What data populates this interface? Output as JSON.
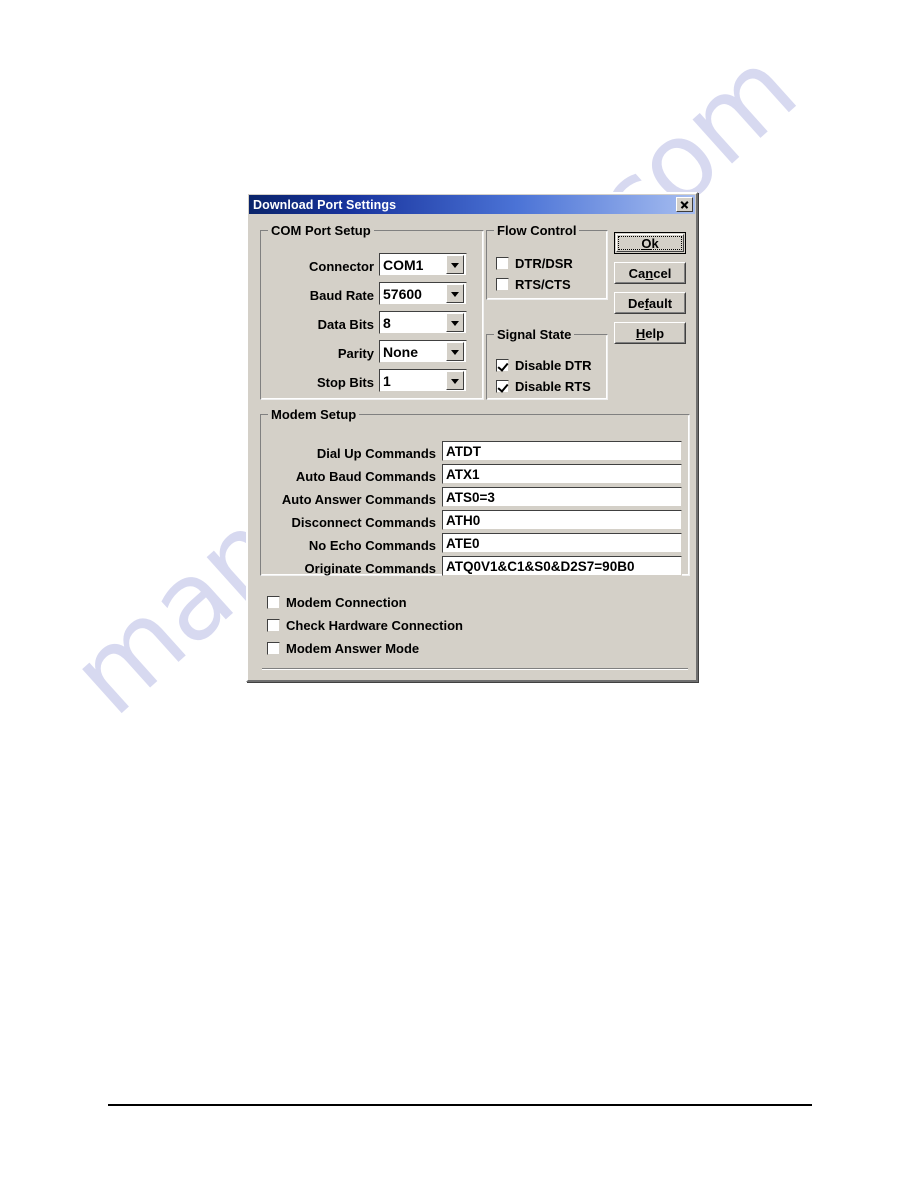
{
  "page": {
    "watermark": "manualshive.com"
  },
  "dialog": {
    "title": "Download Port Settings",
    "close_icon": "close-icon",
    "com_port_setup": {
      "legend": "COM Port Setup",
      "fields": [
        {
          "label": "Connector",
          "value": "COM1"
        },
        {
          "label": "Baud Rate",
          "value": "57600"
        },
        {
          "label": "Data Bits",
          "value": "8"
        },
        {
          "label": "Parity",
          "value": "None"
        },
        {
          "label": "Stop Bits",
          "value": "1"
        }
      ]
    },
    "flow_control": {
      "legend": "Flow Control",
      "items": [
        {
          "label": "DTR/DSR",
          "checked": false
        },
        {
          "label": "RTS/CTS",
          "checked": false
        }
      ]
    },
    "signal_state": {
      "legend": "Signal State",
      "items": [
        {
          "label": "Disable DTR",
          "checked": true
        },
        {
          "label": "Disable RTS",
          "checked": true
        }
      ]
    },
    "buttons": [
      {
        "label": "Ok",
        "accel": "O",
        "default": true
      },
      {
        "label": "Cancel",
        "accel": "n",
        "default": false
      },
      {
        "label": "Default",
        "accel": "f",
        "default": false
      },
      {
        "label": "Help",
        "accel": "H",
        "default": false
      }
    ],
    "modem_setup": {
      "legend": "Modem Setup",
      "fields": [
        {
          "label": "Dial Up Commands",
          "value": "ATDT"
        },
        {
          "label": "Auto Baud Commands",
          "value": "ATX1"
        },
        {
          "label": "Auto Answer Commands",
          "value": "ATS0=3"
        },
        {
          "label": "Disconnect Commands",
          "value": "ATH0"
        },
        {
          "label": "No Echo Commands",
          "value": "ATE0"
        },
        {
          "label": "Originate Commands",
          "value": "ATQ0V1&C1&S0&D2S7=90B0"
        }
      ]
    },
    "options": [
      {
        "label": "Modem Connection",
        "checked": false
      },
      {
        "label": "Check Hardware Connection",
        "checked": false
      },
      {
        "label": "Modem Answer Mode",
        "checked": false
      }
    ]
  }
}
